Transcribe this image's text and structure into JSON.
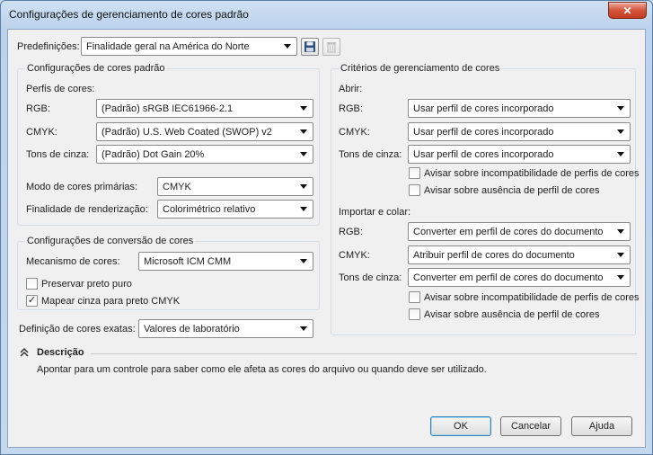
{
  "window": {
    "title": "Configurações de gerenciamento de cores padrão",
    "close_glyph": "✕"
  },
  "presets": {
    "label": "Predefinições:",
    "value": "Finalidade geral na América do Norte"
  },
  "default_settings": {
    "title": "Configurações de cores padrão",
    "profiles_label": "Perfis de cores:",
    "rgb_label": "RGB:",
    "rgb_value": "(Padrão) sRGB IEC61966-2.1",
    "cmyk_label": "CMYK:",
    "cmyk_value": "(Padrão) U.S. Web Coated (SWOP) v2",
    "gray_label": "Tons de cinza:",
    "gray_value": "(Padrão) Dot Gain 20%",
    "primary_mode_label": "Modo de cores primárias:",
    "primary_mode_value": "CMYK",
    "rendering_intent_label": "Finalidade de renderização:",
    "rendering_intent_value": "Colorimétrico relativo"
  },
  "conversion": {
    "title": "Configurações de conversão de cores",
    "engine_label": "Mecanismo de cores:",
    "engine_value": "Microsoft ICM CMM",
    "preserve_black_label": "Preservar preto puro",
    "preserve_black_checked": false,
    "map_gray_label": "Mapear cinza para preto CMYK",
    "map_gray_checked": true
  },
  "spot": {
    "label": "Definição de cores exatas:",
    "value": "Valores de laboratório"
  },
  "policies": {
    "title": "Critérios de gerenciamento de cores",
    "open": {
      "label": "Abrir:",
      "rgb_label": "RGB:",
      "rgb_value": "Usar perfil de cores incorporado",
      "cmyk_label": "CMYK:",
      "cmyk_value": "Usar perfil de cores incorporado",
      "gray_label": "Tons de cinza:",
      "gray_value": "Usar perfil de cores incorporado",
      "warn_mismatch_label": "Avisar sobre incompatibilidade de perfis de cores",
      "warn_mismatch_checked": false,
      "warn_missing_label": "Avisar sobre ausência de perfil de cores",
      "warn_missing_checked": false
    },
    "import": {
      "label": "Importar e colar:",
      "rgb_label": "RGB:",
      "rgb_value": "Converter em perfil de cores do documento",
      "cmyk_label": "CMYK:",
      "cmyk_value": "Atribuir perfil de cores do documento",
      "gray_label": "Tons de cinza:",
      "gray_value": "Converter em perfil de cores do documento",
      "warn_mismatch_label": "Avisar sobre incompatibilidade de perfis de cores",
      "warn_mismatch_checked": false,
      "warn_missing_label": "Avisar sobre ausência de perfil de cores",
      "warn_missing_checked": false
    }
  },
  "description": {
    "title": "Descrição",
    "text": "Apontar para um controle para saber como ele afeta as cores do arquivo ou quando deve ser utilizado."
  },
  "buttons": {
    "ok": "OK",
    "cancel": "Cancelar",
    "help": "Ajuda"
  },
  "check_glyph": "✓",
  "colors": {
    "title_gradient_top": "#cfe0f3",
    "close_red": "#d4553c",
    "client_bg": "#f0f0f0",
    "default_button_border": "#3c7fb1"
  }
}
